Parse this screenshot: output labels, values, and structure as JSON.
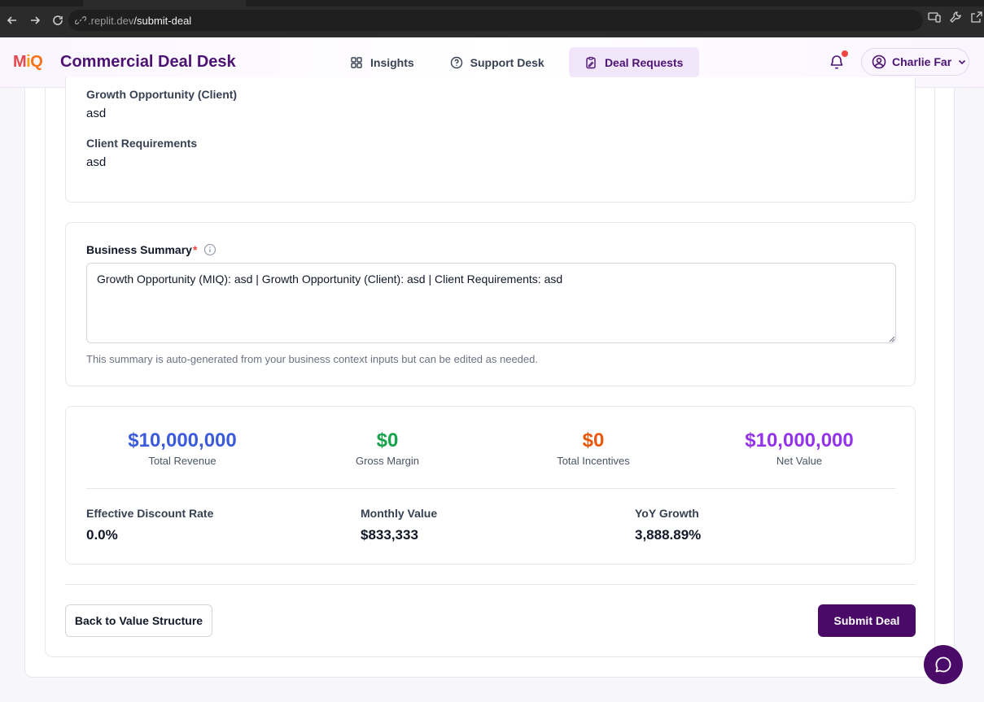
{
  "browser": {
    "url_host": ".replit.dev",
    "url_path": "/submit-deal"
  },
  "header": {
    "logo": {
      "m": "M",
      "i": "i",
      "q": "Q"
    },
    "title": "Commercial Deal Desk",
    "nav": [
      {
        "label": "Insights",
        "icon": "grid-icon"
      },
      {
        "label": "Support Desk",
        "icon": "question-circle-icon"
      },
      {
        "label": "Deal Requests",
        "icon": "clipboard-icon",
        "active": true
      }
    ],
    "notifications_unread": true,
    "user_name": "Charlie Far"
  },
  "business_context": {
    "growth_client_label": "Growth Opportunity (Client)",
    "growth_client_value": "asd",
    "client_requirements_label": "Client Requirements",
    "client_requirements_value": "asd"
  },
  "summary": {
    "label": "Business Summary",
    "required_mark": "*",
    "value": "Growth Opportunity (MIQ): asd | Growth Opportunity (Client): asd | Client Requirements: asd",
    "help": "This summary is auto-generated from your business context inputs but can be edited as needed."
  },
  "metrics": [
    {
      "value": "$10,000,000",
      "label": "Total Revenue",
      "color": "#3b5bdb"
    },
    {
      "value": "$0",
      "label": "Gross Margin",
      "color": "#16a34a"
    },
    {
      "value": "$0",
      "label": "Total Incentives",
      "color": "#ea580c"
    },
    {
      "value": "$10,000,000",
      "label": "Net Value",
      "color": "#9333ea"
    }
  ],
  "stats": [
    {
      "label": "Effective Discount Rate",
      "value": "0.0%"
    },
    {
      "label": "Monthly Value",
      "value": "$833,333"
    },
    {
      "label": "YoY Growth",
      "value": "3,888.89%"
    }
  ],
  "actions": {
    "back_label": "Back to Value Structure",
    "submit_label": "Submit Deal"
  }
}
